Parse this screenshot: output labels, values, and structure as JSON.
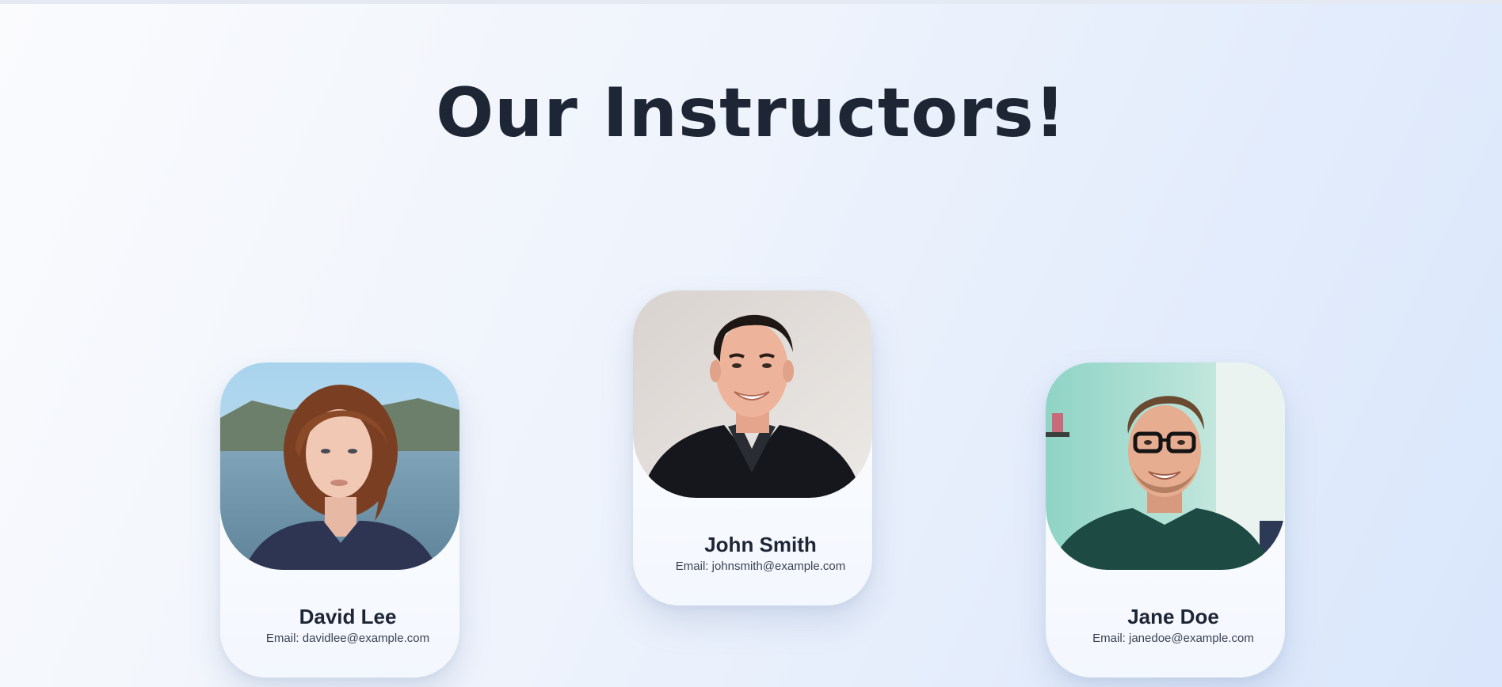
{
  "page": {
    "title": "Our Instructors!"
  },
  "instructors": [
    {
      "name": "David Lee",
      "email": "Email: davidlee@example.com",
      "photo_icon": "portrait-woman-lake-photo"
    },
    {
      "name": "John Smith",
      "email": "Email: johnsmith@example.com",
      "photo_icon": "portrait-man-smiling-photo"
    },
    {
      "name": "Jane Doe",
      "email": "Email: janedoe@example.com",
      "photo_icon": "portrait-man-glasses-photo"
    }
  ],
  "colors": {
    "title": "#1e2636",
    "card_background": "#f3f7fe",
    "page_gradient_start": "#fafbfd",
    "page_gradient_end": "#d9e6fb"
  }
}
